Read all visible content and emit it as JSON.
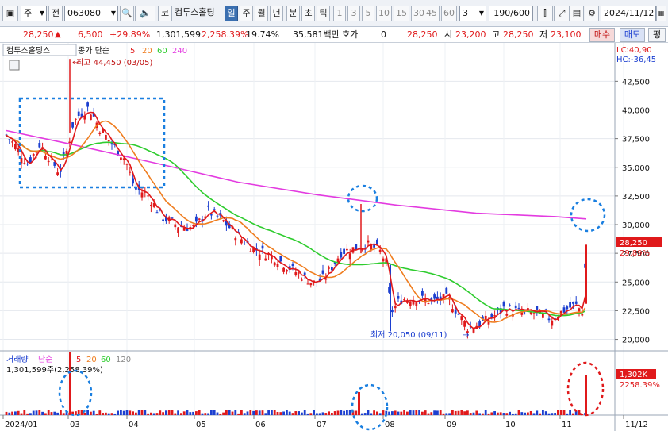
{
  "toolbar": {
    "type_select": "주",
    "prev_label": "전",
    "code": "063080",
    "market_label": "코",
    "stock_name": "컴투스홀딩",
    "periods": [
      "일",
      "주",
      "월",
      "년"
    ],
    "sub_periods": [
      "분",
      "초",
      "틱"
    ],
    "numbers": [
      "1",
      "3",
      "5",
      "10",
      "15",
      "30",
      "45",
      "60"
    ],
    "interval_value": "3",
    "count": "190",
    "count_max": "/600",
    "date": "2024/11/12"
  },
  "quote": {
    "price": "28,250",
    "change": "6,500",
    "change_pct": "+29.89%",
    "volume": "1,301,599",
    "volume_pct": "2,258.39%",
    "turnover": "19.74%",
    "amount": "35,581백만",
    "hoga_label": "호가",
    "hoga_value": "0",
    "hoga_price": "28,250",
    "open_label": "시",
    "open": "23,200",
    "high_label": "고",
    "high": "28,250",
    "low_label": "저",
    "low": "23,100",
    "buy": "매수",
    "sell": "매도",
    "eval": "평"
  },
  "legend": {
    "name": "컴투스홀딩스",
    "ma_label": "종가 단순",
    "ma": [
      "5",
      "20",
      "60",
      "240"
    ],
    "lc": "LC:40,90",
    "hc": "HC:-36,45"
  },
  "annotations": {
    "high": "최고 44,450 (03/05)",
    "low": "최저 20,050 (09/11)",
    "price_tag": "28,250",
    "pct_tag": "29.89%"
  },
  "volume_legend": {
    "label": "거래량",
    "ma_label": "단순",
    "ma": [
      "5",
      "20",
      "60",
      "120"
    ],
    "value": "1,301,599주(2,258.39%)",
    "tag_value": "1,302K",
    "tag_pct": "2258.39%"
  },
  "colors": {
    "ma5": "#e0191b",
    "ma20": "#ef7d1f",
    "ma60": "#2ecc2e",
    "ma240": "#e33be0",
    "ma120": "#888888",
    "up": "#e0191b",
    "down": "#1c3fd0",
    "marker": "#1a7fe0"
  },
  "chart_data": {
    "type": "candlestick",
    "y_ticks": [
      "42,500",
      "40,000",
      "37,500",
      "35,000",
      "32,500",
      "30,000",
      "27,500",
      "25,000",
      "22,500",
      "20,000"
    ],
    "x_ticks": [
      "2024/01",
      "03",
      "04",
      "05",
      "06",
      "07",
      "08",
      "09",
      "10",
      "11",
      "11/12"
    ],
    "ylim": [
      19000,
      45500
    ],
    "key_points": [
      {
        "date": "2024/03/05",
        "value": 44450,
        "label": "최고"
      },
      {
        "date": "2024/09/11",
        "value": 20050,
        "label": "최저"
      },
      {
        "date": "2024/11/12",
        "value": 28250,
        "label": "close"
      }
    ]
  }
}
